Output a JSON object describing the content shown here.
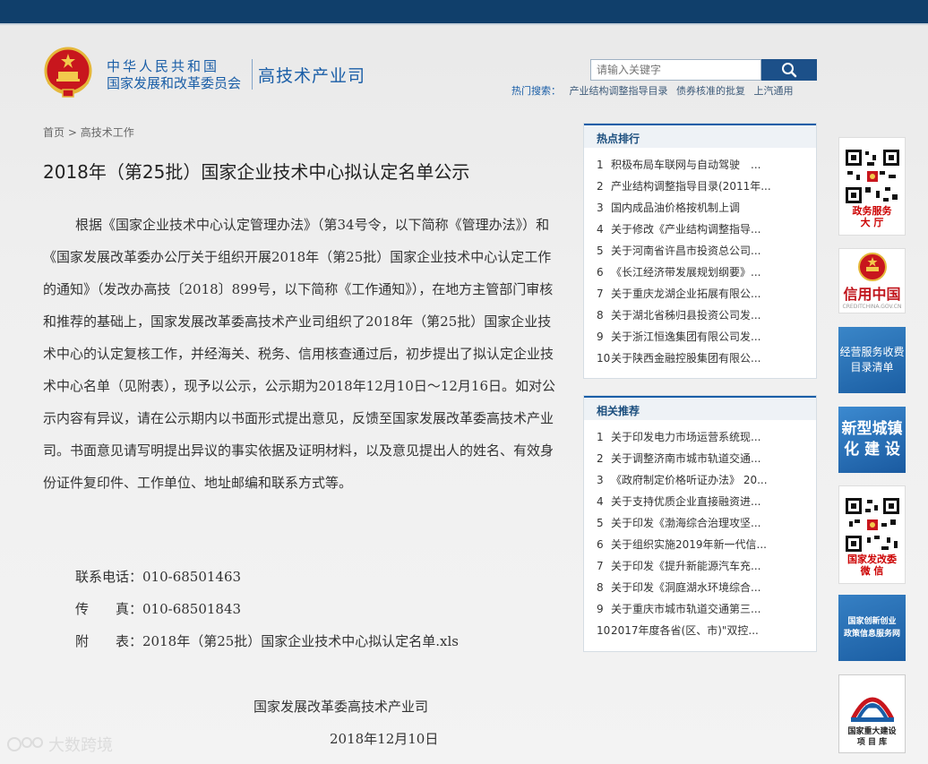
{
  "header": {
    "org_name": "中华人民共和国",
    "ministry": "国家发展和改革委员会",
    "department": "高技术产业司",
    "search_placeholder": "请输入关键字",
    "hot_search_label": "热门搜索：",
    "hot_keywords": [
      "产业结构调整指导目录",
      "债券核准的批复",
      "上汽通用"
    ]
  },
  "breadcrumb": {
    "home": "首页",
    "separator": ">",
    "section": "高技术工作"
  },
  "article": {
    "title": "2018年（第25批）国家企业技术中心拟认定名单公示",
    "body": "根据《国家企业技术中心认定管理办法》（第34号令，以下简称《管理办法》）和《国家发展改革委办公厅关于组织开展2018年（第25批）国家企业技术中心认定工作的通知》（发改办高技〔2018〕899号，以下简称《工作通知》），在地方主管部门审核和推荐的基础上，国家发展改革委高技术产业司组织了2018年（第25批）国家企业技术中心的认定复核工作，并经海关、税务、信用核查通过后，初步提出了拟认定企业技术中心名单（见附表），现予以公示，公示期为2018年12月10日～12月16日。如对公示内容有异议，请在公示期内以书面形式提出意见，反馈至国家发展改革委高技术产业司。书面意见请写明提出异议的事实依据及证明材料，以及意见提出人的姓名、有效身份证件复印件、工作单位、地址邮编和联系方式等。",
    "phone": "联系电话：010-68501463",
    "fax": "传　　真：010-68501843",
    "attachment_label": "附　　表：",
    "attachment_link": "2018年（第25批）国家企业技术中心拟认定名单.xls",
    "sign_org": "国家发展改革委高技术产业司",
    "sign_date": "2018年12月10日"
  },
  "hot_ranking": {
    "title": "热点排行",
    "items": [
      {
        "num": "1",
        "text": "积极布局车联网与自动驾驶　..."
      },
      {
        "num": "2",
        "text": "产业结构调整指导目录(2011年..."
      },
      {
        "num": "3",
        "text": "国内成品油价格按机制上调"
      },
      {
        "num": "4",
        "text": "关于修改《产业结构调整指导..."
      },
      {
        "num": "5",
        "text": "关于河南省许昌市投资总公司..."
      },
      {
        "num": "6",
        "text": "《长江经济带发展规划纲要》..."
      },
      {
        "num": "7",
        "text": "关于重庆龙湖企业拓展有限公..."
      },
      {
        "num": "8",
        "text": "关于湖北省秭归县投资公司发..."
      },
      {
        "num": "9",
        "text": "关于浙江恒逸集团有限公司发..."
      },
      {
        "num": "10",
        "text": "关于陕西金融控股集团有限公..."
      }
    ]
  },
  "related": {
    "title": "相关推荐",
    "items": [
      {
        "num": "1",
        "text": "关于印发电力市场运营系统现..."
      },
      {
        "num": "2",
        "text": "关于调整济南市城市轨道交通..."
      },
      {
        "num": "3",
        "text": "《政府制定价格听证办法》 20..."
      },
      {
        "num": "4",
        "text": "关于支持优质企业直接融资进..."
      },
      {
        "num": "5",
        "text": "关于印发《渤海综合治理攻坚..."
      },
      {
        "num": "6",
        "text": "关于组织实施2019年新一代信..."
      },
      {
        "num": "7",
        "text": "关于印发《提升新能源汽车充..."
      },
      {
        "num": "8",
        "text": "关于印发《洞庭湖水环境综合..."
      },
      {
        "num": "9",
        "text": "关于重庆市城市轨道交通第三..."
      },
      {
        "num": "10",
        "text": "2017年度各省(区、市)\"双控..."
      }
    ]
  },
  "banners": {
    "gov_service": [
      "政务服务",
      "大 厅"
    ],
    "credit_china": "信用中国",
    "credit_china_url": "CREDITCHINA.GOV.CN",
    "fee_list": [
      "经营服务收费",
      "目录清单"
    ],
    "urbanization": [
      "新型城镇",
      "化 建 设"
    ],
    "wechat": [
      "国家发改委",
      "微 信"
    ],
    "innovation": [
      "国家创新创业",
      "政策信息服务网"
    ],
    "major_projects": [
      "国家重大建设",
      "项 目 库"
    ]
  },
  "watermark": "大数跨境"
}
